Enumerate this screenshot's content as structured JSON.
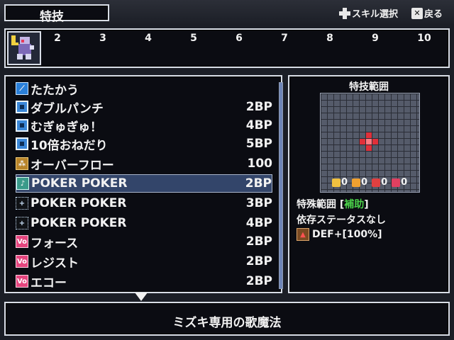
{
  "header": {
    "title": "特技",
    "hints": [
      {
        "icon": "dpad-icon",
        "label": "スキル選択"
      },
      {
        "icon": "x-button-icon",
        "label": "戻る"
      }
    ]
  },
  "party": {
    "slots": [
      "2",
      "3",
      "4",
      "5",
      "6",
      "7",
      "8",
      "9",
      "10"
    ]
  },
  "skills": [
    {
      "name": "たたかう",
      "bp": "",
      "icon": "attack-icon"
    },
    {
      "name": "ダブルパンチ",
      "bp": "2BP",
      "icon": "skill-square-icon"
    },
    {
      "name": "むぎゅぎゅ！",
      "bp": "4BP",
      "icon": "skill-square-icon"
    },
    {
      "name": "10倍おねだり",
      "bp": "5BP",
      "icon": "skill-square-icon"
    },
    {
      "name": "オーバーフロー",
      "bp": "100",
      "icon": "overflow-icon"
    },
    {
      "name": "POKER POKER",
      "bp": "2BP",
      "icon": "song-note-icon",
      "selected": true
    },
    {
      "name": "POKER POKER",
      "bp": "3BP",
      "icon": "song-level2-icon"
    },
    {
      "name": "POKER POKER",
      "bp": "4BP",
      "icon": "song-level3-icon"
    },
    {
      "name": "フォース",
      "bp": "2BP",
      "icon": "vo-icon"
    },
    {
      "name": "レジスト",
      "bp": "2BP",
      "icon": "vo-icon"
    },
    {
      "name": "エコー",
      "bp": "2BP",
      "icon": "vo-icon"
    }
  ],
  "info": {
    "range_title": "特技範囲",
    "stats": [
      "0",
      "0",
      "0",
      "0"
    ],
    "special_label": "特殊範囲 [",
    "special_tag": "補助",
    "special_end": "]",
    "depend": "依存ステータスなし",
    "buff": "DEF+[100%]"
  },
  "description": "ミズキ専用の歌魔法",
  "colors": {
    "selected_row": "#33456a",
    "tag_green": "#4ad04a",
    "range_red": "#e0303a"
  }
}
